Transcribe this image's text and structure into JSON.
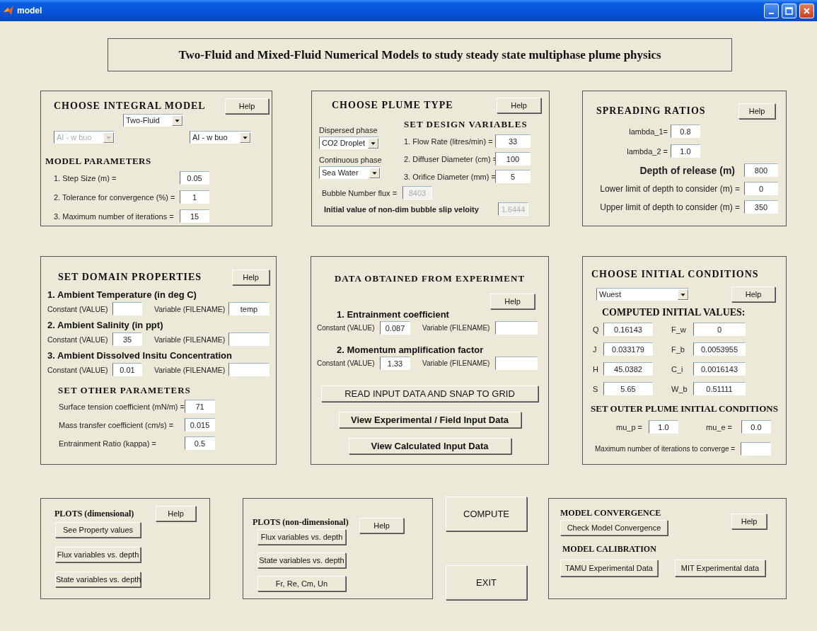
{
  "window": {
    "title": "model"
  },
  "heading": "Two-Fluid and Mixed-Fluid Numerical Models to study steady state multiphase plume physics",
  "integral_model": {
    "title": "CHOOSE INTEGRAL MODEL",
    "help": "Help",
    "model": {
      "value": "Two-Fluid"
    },
    "left_option": {
      "value": "AI - w buo",
      "disabled": true
    },
    "right_option": {
      "value": "AI - w buo",
      "disabled": false
    },
    "parameters_title": "MODEL PARAMETERS",
    "parameters": [
      {
        "label": "1. Step Size (m) =",
        "value": "0.05"
      },
      {
        "label": "2. Tolerance for convergence (%) =",
        "value": "1"
      },
      {
        "label": "3. Maximum number of iterations =",
        "value": "15"
      }
    ]
  },
  "plume_type": {
    "title": "CHOOSE PLUME TYPE",
    "help": "Help",
    "dispersed_label": "Dispersed phase",
    "dispersed": {
      "value": "CO2 Droplet"
    },
    "continuous_label": "Continuous phase",
    "continuous": {
      "value": "Sea Water"
    },
    "design_title": "SET DESIGN VARIABLES",
    "design": [
      {
        "label": "1. Flow Rate (litres/min) =",
        "value": "33"
      },
      {
        "label": "2. Diffuser Diameter (cm) =",
        "value": "100"
      },
      {
        "label": "3. Orifice Diameter (mm) =",
        "value": "5"
      }
    ],
    "bubble_flux": {
      "label": "Bubble Number flux =",
      "value": "8403",
      "disabled": true
    },
    "slip_velocity": {
      "label": "Initial value of non-dim bubble slip veloity",
      "value": "1.6444",
      "disabled": true
    }
  },
  "spreading": {
    "title": "SPREADING  RATIOS",
    "help": "Help",
    "lambdas": [
      {
        "label": "lambda_1=",
        "value": "0.8"
      },
      {
        "label": "lambda_2 =",
        "value": "1.0"
      }
    ],
    "depth_label": "Depth of release (m)",
    "depth": "800",
    "limits": [
      {
        "label": "Lower limit of depth to consider (m) =",
        "value": "0"
      },
      {
        "label": "Upper limit of depth to consider (m) =",
        "value": "350"
      }
    ]
  },
  "domain": {
    "title": "SET  DOMAIN  PROPERTIES",
    "help": "Help",
    "properties": [
      {
        "title": "1. Ambient Temperature (in deg C)",
        "constant_label": "Constant (VALUE)",
        "variable_label": "Variable (FILENAME)",
        "variable": "temp"
      },
      {
        "title": "2. Ambient Salinity (in ppt)",
        "constant_label": "Constant (VALUE)",
        "constant": "35",
        "variable_label": "Variable (FILENAME)"
      },
      {
        "title": "3. Ambient Dissolved Insitu Concentration",
        "constant_label": "Constant (VALUE)",
        "constant": "0.01",
        "variable_label": "Variable (FILENAME)"
      }
    ],
    "other_title": "SET OTHER PARAMETERS",
    "other": [
      {
        "label": "Surface tension coefficient (mN/m) =",
        "value": "71"
      },
      {
        "label": "Mass transfer coefficient (cm/s) =",
        "value": "0.015"
      },
      {
        "label": "Entrainment Ratio (kappa) =",
        "value": "0.5"
      }
    ]
  },
  "experiment": {
    "title": "DATA  OBTAINED  FROM  EXPERIMENT",
    "help": "Help",
    "coefficients": [
      {
        "title": "1. Entrainment coefficient",
        "constant_label": "Constant (VALUE)",
        "constant": "0.087",
        "variable_label": "Variable (FILENAME)"
      },
      {
        "title": "2. Momentum amplification factor",
        "constant_label": "Constant (VALUE)",
        "constant": "1.33",
        "variable_label": "Variable (FILENAME)"
      }
    ],
    "buttons": [
      {
        "label": "READ  INPUT DATA  AND  SNAP  TO  GRID",
        "kind": "plain"
      },
      {
        "label": "View Experimental / Field Input Data",
        "kind": "bold"
      },
      {
        "label": "View Calculated Input Data",
        "kind": "bold"
      }
    ]
  },
  "initial": {
    "title": "CHOOSE  INITIAL  CONDITIONS",
    "method": {
      "value": "Wuest"
    },
    "help": "Help",
    "computed_title": "COMPUTED INITIAL VALUES:",
    "computed": [
      {
        "label": "Q",
        "value": "0.16143"
      },
      {
        "label": "F_w",
        "value": "0"
      },
      {
        "label": "J",
        "value": "0.033179"
      },
      {
        "label": "F_b",
        "value": "0.0053955"
      },
      {
        "label": "H",
        "value": "45.0382"
      },
      {
        "label": "C_i",
        "value": "0.0016143"
      },
      {
        "label": "S",
        "value": "5.65"
      },
      {
        "label": "W_b",
        "value": "0.51111"
      }
    ],
    "outer_title": "SET OUTER PLUME INITIAL CONDITIONS",
    "outer": [
      {
        "label": "mu_p =",
        "value": "1.0"
      },
      {
        "label": "mu_e  =",
        "value": "0.0"
      }
    ],
    "iterations_label": "Maximum number of iterations to converge ="
  },
  "plots_dimensional": {
    "title": "PLOTS (dimensional)",
    "help": "Help",
    "buttons": [
      "See Property values",
      "Flux variables vs. depth",
      "State variables vs. depth"
    ]
  },
  "plots_nondimensional": {
    "title": "PLOTS (non-dimensional)",
    "help": "Help",
    "buttons": [
      "Flux variables vs. depth",
      "State variables vs. depth",
      "Fr, Re, Cm, Un"
    ]
  },
  "actions": [
    "COMPUTE",
    "EXIT"
  ],
  "convergence": {
    "title": "MODEL CONVERGENCE",
    "button": "Check Model Convergence",
    "help": "Help",
    "calibration_title": "MODEL CALIBRATION",
    "calibration_buttons": [
      "TAMU Experimental Data",
      "MIT Experimental data"
    ]
  }
}
